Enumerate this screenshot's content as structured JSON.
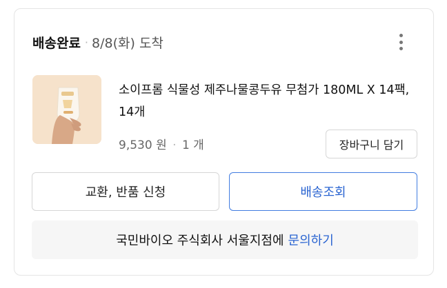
{
  "order": {
    "status": "배송완료",
    "separator": "·",
    "delivery_date": "8/8(화) 도착"
  },
  "product": {
    "name": "소이프롬 식물성 제주나물콩두유 무첨가 180ML X 14팩, 14개",
    "price": "9,530 원",
    "quantity": "1 개",
    "image_icon": "soymilk-pouch-product-image"
  },
  "buttons": {
    "add_to_cart": "장바구니 담기",
    "exchange_return": "교환, 반품 신청",
    "track_delivery": "배송조회"
  },
  "inquiry": {
    "seller": "국민바이오 주식회사 서울지점에",
    "link": "문의하기"
  },
  "colors": {
    "accent": "#2a64d1",
    "border": "#d6d6d6",
    "inquiry_bg": "#f6f6f6"
  }
}
